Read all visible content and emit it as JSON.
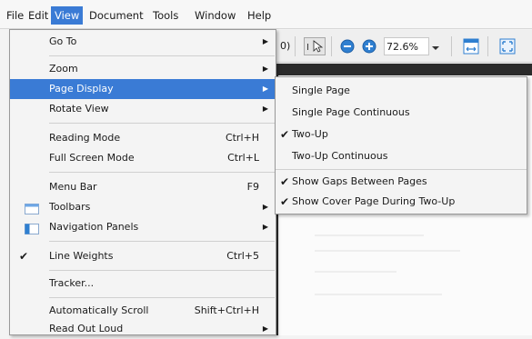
{
  "menubar": {
    "items": [
      "File",
      "Edit",
      "View",
      "Document",
      "Tools",
      "Window",
      "Help"
    ]
  },
  "toolbar": {
    "partial_text": "0)",
    "zoom_value": "72.6%"
  },
  "view_menu": {
    "go_to": "Go To",
    "zoom": "Zoom",
    "page_display": "Page Display",
    "rotate_view": "Rotate View",
    "reading_mode": "Reading Mode",
    "reading_mode_shortcut": "Ctrl+H",
    "full_screen_mode": "Full Screen Mode",
    "full_screen_shortcut": "Ctrl+L",
    "menu_bar": "Menu Bar",
    "menu_bar_shortcut": "F9",
    "toolbars": "Toolbars",
    "navigation_panels": "Navigation Panels",
    "line_weights": "Line Weights",
    "line_weights_shortcut": "Ctrl+5",
    "tracker": "Tracker...",
    "auto_scroll": "Automatically Scroll",
    "auto_scroll_shortcut": "Shift+Ctrl+H",
    "read_out_loud": "Read Out Loud"
  },
  "page_display_submenu": {
    "single_page": "Single Page",
    "single_page_continuous": "Single Page Continuous",
    "two_up": "Two-Up",
    "two_up_continuous": "Two-Up Continuous",
    "show_gaps": "Show Gaps Between Pages",
    "show_cover": "Show Cover Page During Two-Up"
  },
  "colors": {
    "highlight": "#3a7bd5",
    "toolbar_accent": "#2f7fd0"
  }
}
